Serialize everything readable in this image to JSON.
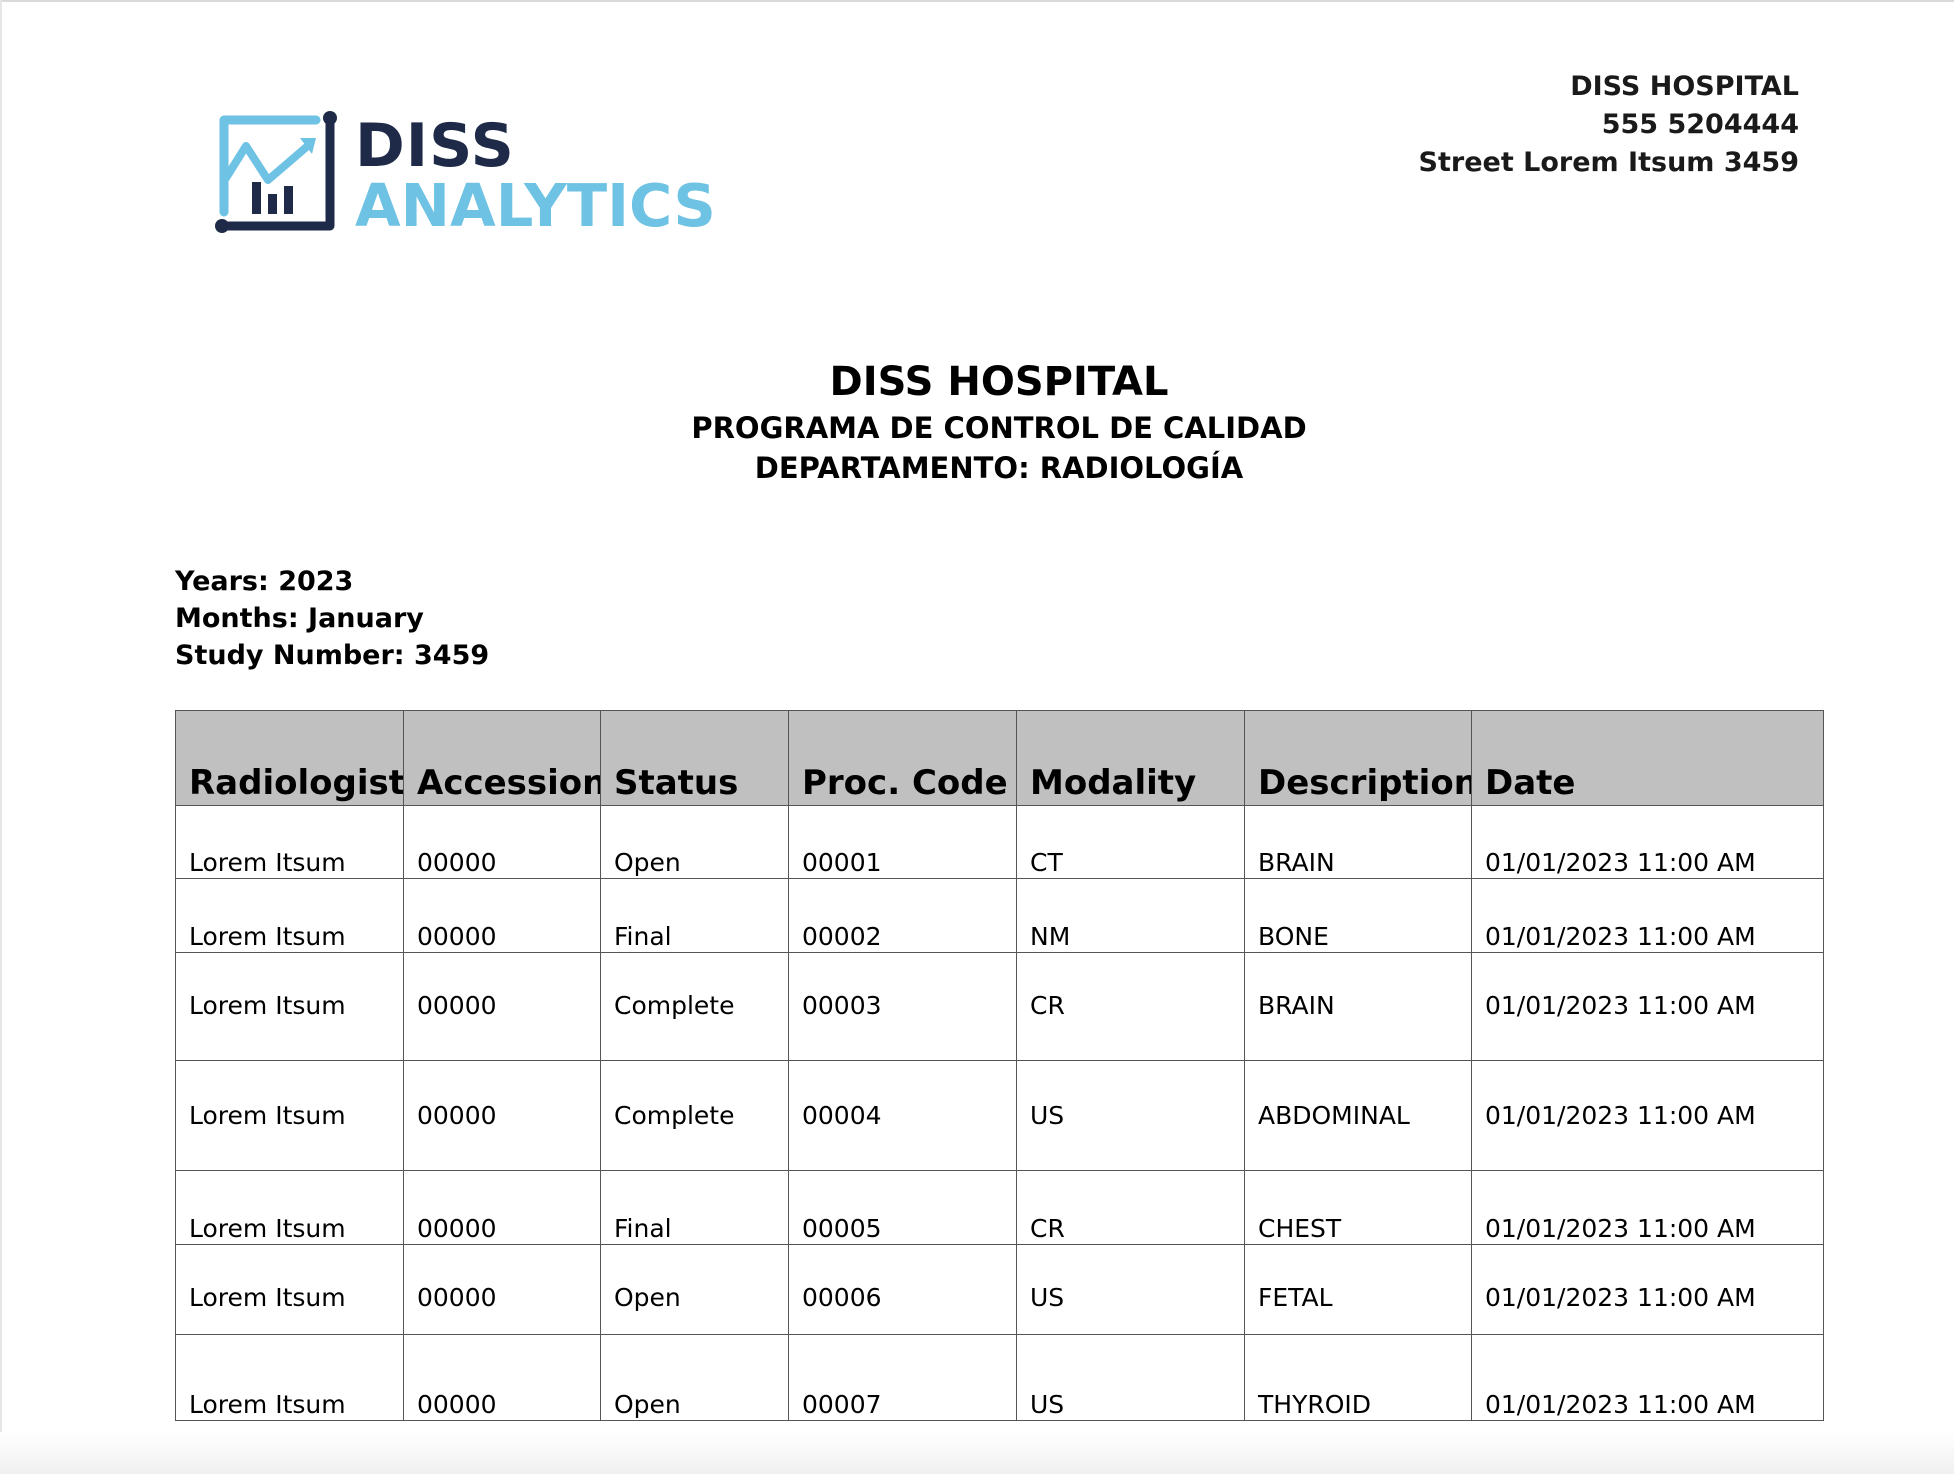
{
  "logo": {
    "word_top": "DISS",
    "word_bottom": "ANALYTICS",
    "colors": {
      "dark": "#1e2a47",
      "light": "#6ec2e4"
    }
  },
  "address": {
    "name": "DISS HOSPITAL",
    "phone": "555 5204444",
    "street": "Street Lorem Itsum 3459"
  },
  "title": {
    "main": "DISS HOSPITAL",
    "program": "PROGRAMA DE CONTROL DE CALIDAD",
    "department": "DEPARTAMENTO: RADIOLOGÍA"
  },
  "meta": {
    "years": "Years: 2023",
    "months": "Months: January",
    "study_number": "Study Number: 3459"
  },
  "table": {
    "header_bg": "#c0c0c0",
    "columns": [
      "Radiologist",
      "Accession",
      "Status",
      "Proc. Code",
      "Modality",
      "Description",
      "Date"
    ],
    "rows": [
      [
        "Lorem Itsum",
        "00000",
        "Open",
        "00001",
        "CT",
        "BRAIN",
        "01/01/2023 11:00 AM"
      ],
      [
        "Lorem Itsum",
        "00000",
        "Final",
        "00002",
        "NM",
        "BONE",
        "01/01/2023 11:00 AM"
      ],
      [
        "Lorem Itsum",
        "00000",
        "Complete",
        "00003",
        "CR",
        "BRAIN",
        "01/01/2023 11:00 AM"
      ],
      [
        "Lorem Itsum",
        "00000",
        "Complete",
        "00004",
        "US",
        "ABDOMINAL",
        "01/01/2023 11:00 AM"
      ],
      [
        "Lorem Itsum",
        "00000",
        "Final",
        "00005",
        "CR",
        "CHEST",
        "01/01/2023 11:00 AM"
      ],
      [
        "Lorem Itsum",
        "00000",
        "Open",
        "00006",
        "US",
        "FETAL",
        "01/01/2023 11:00 AM"
      ],
      [
        "Lorem Itsum",
        "00000",
        "Open",
        "00007",
        "US",
        "THYROID",
        "01/01/2023 11:00 AM"
      ]
    ]
  }
}
